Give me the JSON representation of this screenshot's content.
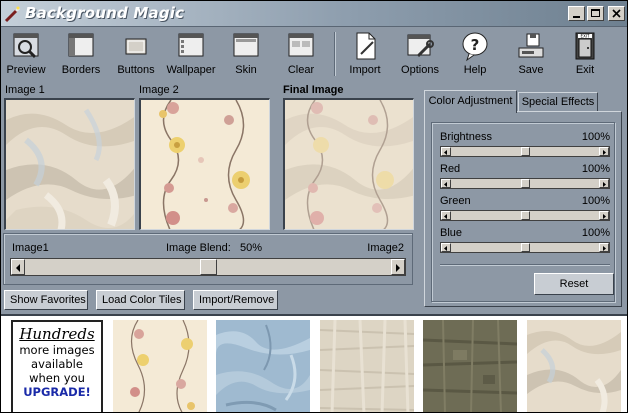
{
  "window": {
    "title": "Background Magic"
  },
  "toolbar": {
    "items": [
      {
        "label": "Preview",
        "icon": "preview-icon"
      },
      {
        "label": "Borders",
        "icon": "borders-icon"
      },
      {
        "label": "Buttons",
        "icon": "buttons-icon"
      },
      {
        "label": "Wallpaper",
        "icon": "wallpaper-icon"
      },
      {
        "label": "Skin",
        "icon": "skin-icon"
      },
      {
        "label": "Clear",
        "icon": "clear-icon"
      },
      {
        "label": "Import",
        "icon": "import-icon"
      },
      {
        "label": "Options",
        "icon": "options-icon"
      },
      {
        "label": "Help",
        "icon": "help-icon"
      },
      {
        "label": "Save",
        "icon": "save-icon"
      },
      {
        "label": "Exit",
        "icon": "exit-icon"
      }
    ]
  },
  "images": {
    "image1_label": "Image 1",
    "image2_label": "Image 2",
    "final_label": "Final Image"
  },
  "blend": {
    "left_label": "Image1",
    "mid_label": "Image Blend:",
    "value_text": "50%",
    "right_label": "Image2",
    "value": 50
  },
  "buttons": {
    "show_favorites": "Show Favorites",
    "load_color_tiles": "Load Color Tiles",
    "import_remove": "Import/Remove"
  },
  "tabs": {
    "color_adjustment": "Color Adjustment",
    "special_effects": "Special Effects"
  },
  "adjust": {
    "sliders": [
      {
        "name": "Brightness",
        "value_text": "100%",
        "value": 100
      },
      {
        "name": "Red",
        "value_text": "100%",
        "value": 100
      },
      {
        "name": "Green",
        "value_text": "100%",
        "value": 100
      },
      {
        "name": "Blue",
        "value_text": "100%",
        "value": 100
      }
    ],
    "reset_label": "Reset"
  },
  "upgrade": {
    "line1": "Hundreds",
    "line2": "more images",
    "line3": "available",
    "line4": "when you",
    "line5": "UPGRADE!"
  },
  "colors": {
    "chrome": "#8d98a5",
    "title_gradient_start": "#c4cfd9",
    "upgrade_blue": "#1a2aa8"
  }
}
